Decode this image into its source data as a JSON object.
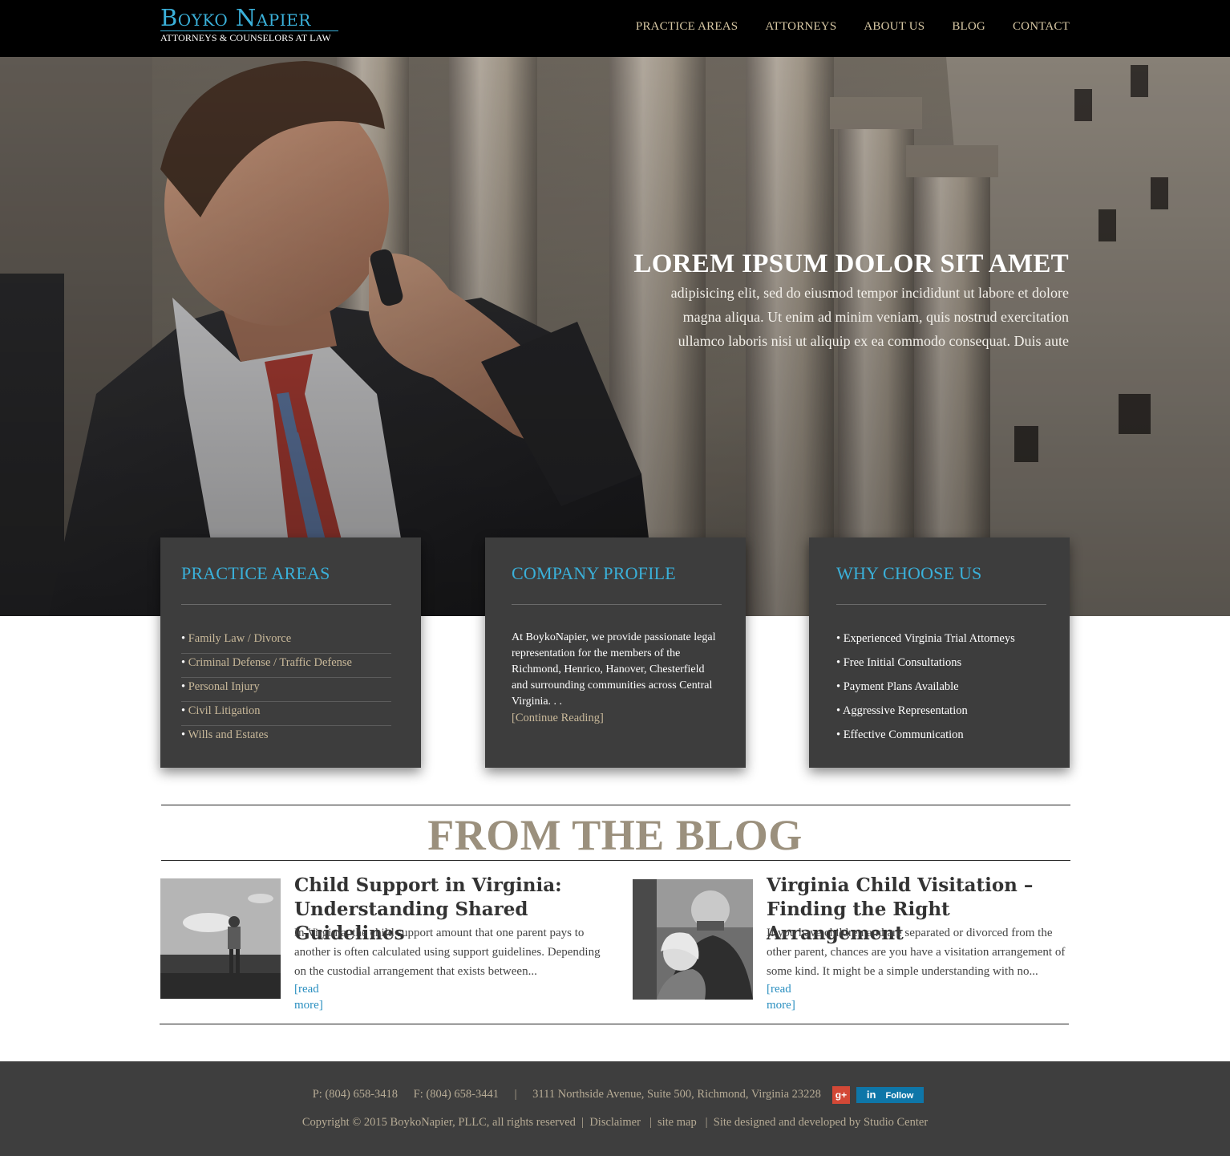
{
  "header": {
    "logo_name": "Boyko Napier",
    "logo_tagline": "ATTORNEYS & COUNSELORS AT LAW",
    "nav": [
      "PRACTICE AREAS",
      "ATTORNEYS",
      "ABOUT US",
      "BLOG",
      "CONTACT"
    ]
  },
  "hero": {
    "title": "LOREM IPSUM DOLOR SIT AMET",
    "lines": [
      "adipisicing elit, sed do eiusmod tempor incididunt ut labore et dolore",
      "magna aliqua. Ut enim ad minim veniam, quis nostrud exercitation",
      "ullamco laboris nisi ut aliquip ex ea commodo consequat. Duis aute"
    ]
  },
  "practice_areas": {
    "title": "PRACTICE AREAS",
    "items": [
      "Family Law / Divorce",
      "Criminal Defense / Traffic Defense",
      "Personal Injury",
      "Civil Litigation",
      "Wills and Estates"
    ]
  },
  "company_profile": {
    "title": "COMPANY PROFILE",
    "text": "At BoykoNapier, we provide passionate legal representation for the members of the Richmond, Henrico, Hanover, Chesterfield and surrounding communities across Central Virginia. . .",
    "link": "[Continue Reading]"
  },
  "why_choose_us": {
    "title": "WHY CHOOSE US",
    "items": [
      "Experienced Virginia Trial Attorneys",
      "Free Initial Consultations",
      "Payment Plans Available",
      "Aggressive Representation",
      "Effective Communication"
    ]
  },
  "blog": {
    "heading": "FROM THE BLOG",
    "posts": [
      {
        "title": "Child Support in Virginia: Understanding Shared Guidelines",
        "excerpt": "In Virginia, the child support amount that one parent pays to another is often calculated using support guidelines. Depending on the custodial arrangement that exists between...",
        "read_more": "[read more]"
      },
      {
        "title": "Virginia Child Visitation – Finding the Right Arrangement",
        "excerpt": "If you have children and are separated or divorced from the other parent, chances are you have a visitation arrangement of some kind. It might be a simple understanding with no...",
        "read_more": "[read more]"
      }
    ]
  },
  "footer": {
    "phone": "P: (804) 658-3418",
    "fax": "F: (804) 658-3441",
    "separator": "|",
    "address": "3111 Northside Avenue, Suite 500, Richmond, Virginia 23228",
    "gplus": "g+",
    "linkedin_in": "in",
    "linkedin_label": "Follow",
    "copyright": "Copyright © 2015 BoykoNapier, PLLC, all rights reserved",
    "disclaimer": "Disclaimer",
    "site_map": "site map",
    "credit": "Site designed and developed by Studio Center"
  }
}
